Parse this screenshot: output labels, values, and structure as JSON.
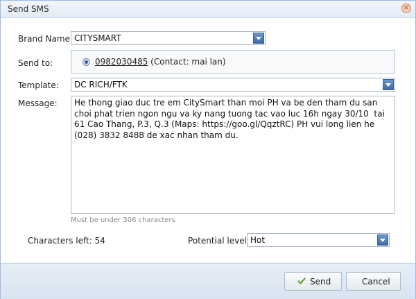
{
  "window": {
    "title": "Send SMS",
    "close_glyph": "×"
  },
  "brand": {
    "label": "Brand Name:",
    "value": "CITYSMART"
  },
  "send_to": {
    "label": "Send to:",
    "phone": "0982030485",
    "contact": " (Contact: mai lan)"
  },
  "template": {
    "label": "Template:",
    "value": "DC RICH/FTK"
  },
  "message": {
    "label": "Message:",
    "value": "He thong giao duc tre em CitySmart than moi PH va be den tham du san choi phat trien ngon ngu va ky nang tuong tac vao luc 16h ngay 30/10  tai 61 Cao Thang, P.3, Q.3 (Maps: https://goo.gl/QqztRC) PH vui long lien he (028) 3832 8488 de xac nhan tham du.",
    "hint": "Must be under 306 characters"
  },
  "characters_left": {
    "text": "Characters left: 54"
  },
  "potential": {
    "label": "Potential level:",
    "value": "Hot"
  },
  "buttons": {
    "send": "Send",
    "cancel": "Cancel"
  },
  "icons": {
    "close": "close-icon",
    "send": "checkmark-icon",
    "dropdown": "chevron-down-icon"
  },
  "colors": {
    "accent": "#3d6aa8",
    "check": "#5aa62b",
    "close": "#d48a67"
  }
}
